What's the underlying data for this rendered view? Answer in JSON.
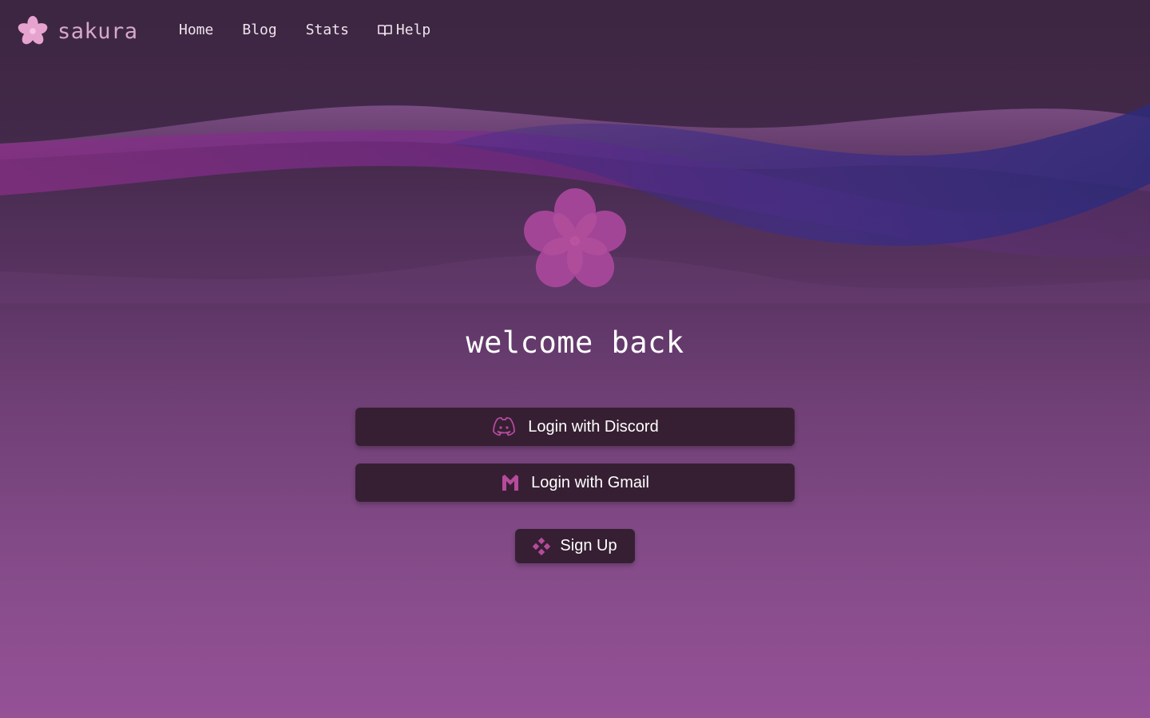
{
  "nav": {
    "brand": "sakura",
    "links": [
      {
        "label": "Home"
      },
      {
        "label": "Blog"
      },
      {
        "label": "Stats"
      },
      {
        "label": "Help",
        "icon": "book-icon"
      }
    ]
  },
  "hero": {
    "logo_icon": "sakura-flower-icon",
    "heading": "welcome back"
  },
  "auth": {
    "discord": {
      "label": "Login with Discord",
      "icon": "discord-icon"
    },
    "gmail": {
      "label": "Login with Gmail",
      "icon": "gmail-icon"
    },
    "signup": {
      "label": "Sign Up",
      "icon": "diamond-cluster-icon"
    }
  },
  "colors": {
    "background_top": "#3c2641",
    "background_bottom": "#955196",
    "button_bg": "#361f33",
    "accent_pink": "#b54b9c",
    "brand_text": "#d6a8c9"
  }
}
